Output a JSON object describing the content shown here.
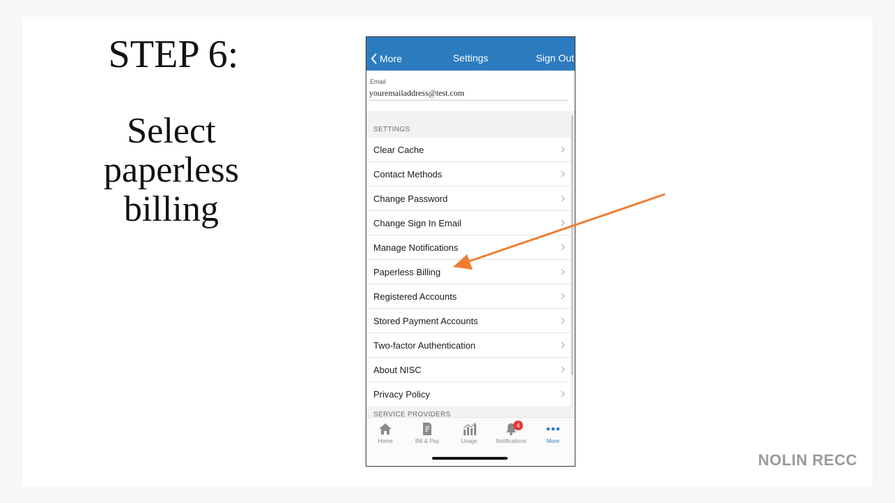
{
  "colors": {
    "accent": "#2c7bbf",
    "arrow": "#ef7d32"
  },
  "slide": {
    "step_title": "STEP 6:",
    "instruction": "Select paperless billing",
    "brand": "NOLIN RECC"
  },
  "nav": {
    "back_label": "More",
    "title": "Settings",
    "right_label": "Sign Out"
  },
  "email": {
    "label": "Email",
    "value": "youremailaddress@test.com"
  },
  "settings": {
    "header": "SETTINGS",
    "items": [
      {
        "label": "Clear Cache"
      },
      {
        "label": "Contact Methods"
      },
      {
        "label": "Change Password"
      },
      {
        "label": "Change Sign In Email"
      },
      {
        "label": "Manage Notifications"
      },
      {
        "label": "Paperless Billing"
      },
      {
        "label": "Registered Accounts"
      },
      {
        "label": "Stored Payment Accounts"
      },
      {
        "label": "Two-factor Authentication"
      },
      {
        "label": "About NISC"
      },
      {
        "label": "Privacy Policy"
      }
    ],
    "next_header": "SERVICE PROVIDERS"
  },
  "tabs": {
    "items": [
      {
        "label": "Home",
        "icon": "home-icon"
      },
      {
        "label": "Bill & Pay",
        "icon": "bill-icon"
      },
      {
        "label": "Usage",
        "icon": "usage-icon"
      },
      {
        "label": "Notifications",
        "icon": "bell-icon",
        "badge": "4"
      },
      {
        "label": "More",
        "icon": "more-icon",
        "active": true
      }
    ]
  }
}
